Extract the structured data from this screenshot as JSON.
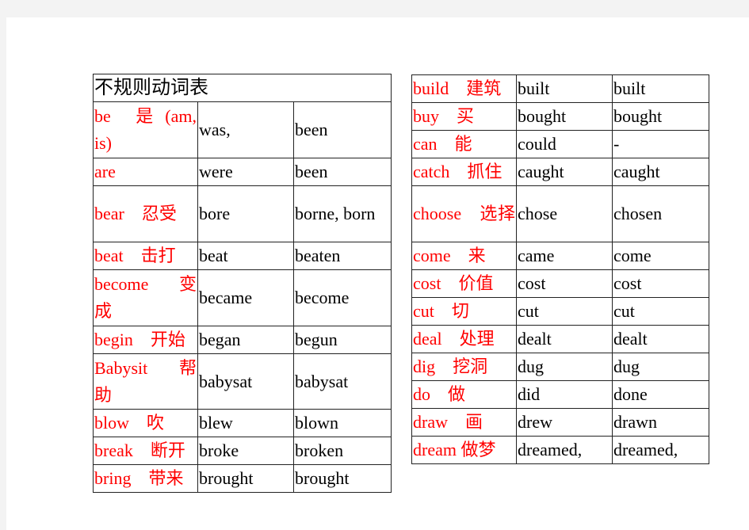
{
  "title": "不规则动词表",
  "left_table": [
    {
      "verb": "be　是 (am, is)",
      "past": "was,",
      "participle": "been"
    },
    {
      "verb": "are",
      "past": "were",
      "participle": "been"
    },
    {
      "verb": "bear　忍受",
      "past": "bore",
      "participle": "borne, born"
    },
    {
      "verb": "beat　击打",
      "past": "beat",
      "participle": "beaten"
    },
    {
      "verb": "become　变成",
      "past": "became",
      "participle": "become"
    },
    {
      "verb": "begin　开始",
      "past": "began",
      "participle": "begun"
    },
    {
      "verb": "Babysit　帮助",
      "past": "babysat",
      "participle": "babysat"
    },
    {
      "verb": "blow　吹",
      "past": "blew",
      "participle": "blown"
    },
    {
      "verb": "break　断开",
      "past": "broke",
      "participle": "broken"
    },
    {
      "verb": "bring　带来",
      "past": "brought",
      "participle": "brought"
    }
  ],
  "right_table": [
    {
      "verb": "build　建筑",
      "past": "built",
      "participle": "built"
    },
    {
      "verb": "buy　买",
      "past": "bought",
      "participle": "bought"
    },
    {
      "verb": "can　能",
      "past": "could",
      "participle": "-"
    },
    {
      "verb": "catch　抓住",
      "past": "caught",
      "participle": "caught"
    },
    {
      "verb": "choose　选择",
      "past": "chose",
      "participle": "chosen"
    },
    {
      "verb": "come　来",
      "past": "came",
      "participle": "come"
    },
    {
      "verb": "cost　价值",
      "past": "cost",
      "participle": "cost"
    },
    {
      "verb": "cut　切",
      "past": "cut",
      "participle": "cut"
    },
    {
      "verb": "deal　处理",
      "past": "dealt",
      "participle": "dealt"
    },
    {
      "verb": "dig　挖洞",
      "past": "dug",
      "participle": "dug"
    },
    {
      "verb": "do　做",
      "past": "did",
      "participle": "done"
    },
    {
      "verb": "draw　画",
      "past": "drew",
      "participle": "drawn"
    },
    {
      "verb": "dream 做梦",
      "past": "dreamed,",
      "participle": "dreamed,"
    }
  ],
  "colors": {
    "verb": "#ff0000",
    "text": "#000000",
    "border": "#222222",
    "background": "#f3f3f3",
    "page": "#ffffff"
  }
}
